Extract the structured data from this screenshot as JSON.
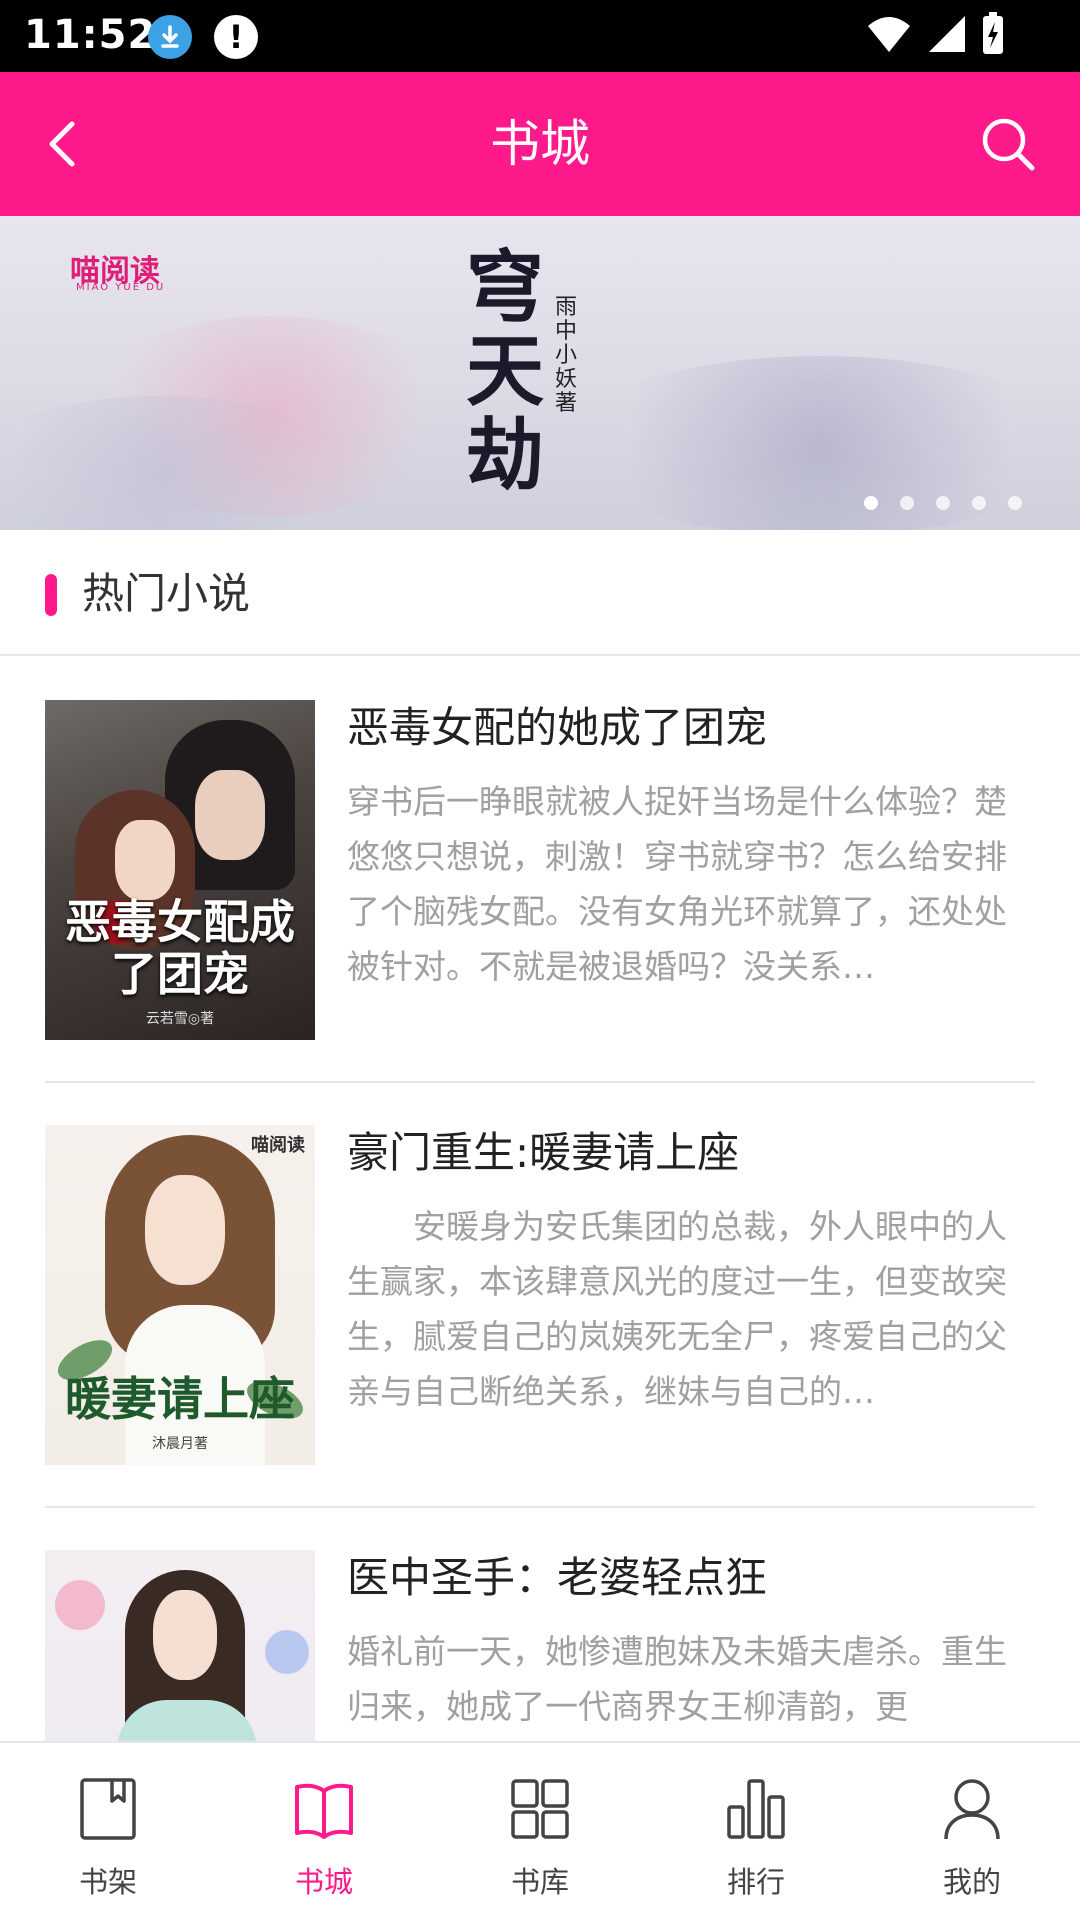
{
  "status_bar": {
    "time": "11:52"
  },
  "header": {
    "title": "书城"
  },
  "banner": {
    "logo": "喵阅读",
    "logo_sub": "MIAO YUE DU",
    "book_title": "穹天劫",
    "author": "雨中小妖著",
    "slide_count": 5,
    "active_slide": 1
  },
  "section": {
    "title": "热门小说"
  },
  "books": [
    {
      "title": "恶毒女配的她成了团宠",
      "description": "穿书后一睁眼就被人捉奸当场是什么体验？楚悠悠只想说，刺激！穿书就穿书？怎么给安排了个脑残女配。没有女角光环就算了，还处处被针对。不就是被退婚吗？没关系…",
      "cover_text": "恶毒女配成了团宠",
      "cover_author": "云若雪◎著"
    },
    {
      "title": "豪门重生:暖妻请上座",
      "description": "　　安暖身为安氏集团的总裁，外人眼中的人生赢家，本该肆意风光的度过一生，但变故突生，腻爱自己的岚姨死无全尸，疼爱自己的父亲与自己断绝关系，继妹与自己的…",
      "cover_text": "暖妻请上座",
      "cover_author": "沐晨月著",
      "cover_logo": "喵阅读"
    },
    {
      "title": "医中圣手：老婆轻点狂",
      "description": "婚礼前一天，她惨遭胞妹及未婚夫虐杀。重生归来，她成了一代商界女王柳清韵，更",
      "cover_text": "",
      "cover_author": ""
    }
  ],
  "nav": [
    {
      "label": "书架",
      "icon": "bookshelf-icon",
      "active": false
    },
    {
      "label": "书城",
      "icon": "open-book-icon",
      "active": true
    },
    {
      "label": "书库",
      "icon": "grid-icon",
      "active": false
    },
    {
      "label": "排行",
      "icon": "bar-chart-icon",
      "active": false
    },
    {
      "label": "我的",
      "icon": "user-icon",
      "active": false
    }
  ],
  "colors": {
    "accent": "#ff1a8c",
    "status_bar": "#000000",
    "desc_text": "#a0a0a0"
  }
}
